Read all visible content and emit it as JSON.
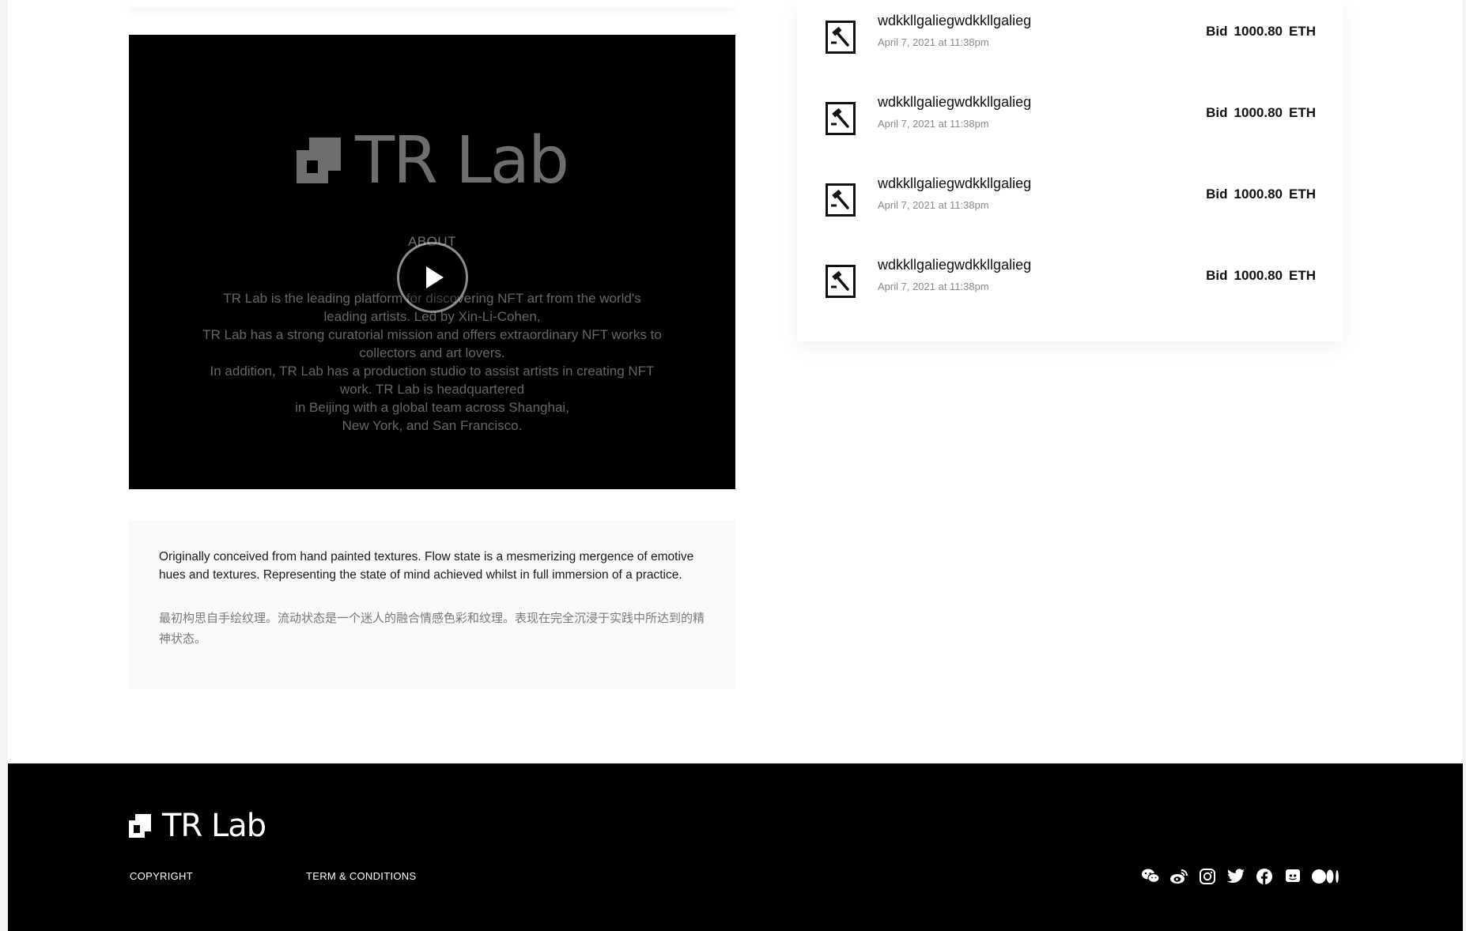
{
  "video": {
    "logo_text": "TR Lab",
    "about_heading": "ABOUT",
    "description_lines": [
      "TR Lab is the leading platform for discovering NFT art from the world's",
      "leading artists. Led by Xin-Li-Cohen,",
      "TR Lab has a strong curatorial mission and offers extraordinary NFT works to",
      "collectors and art lovers.",
      "In addition, TR Lab has a production studio to assist artists in creating NFT",
      "work. TR Lab is headquartered",
      "in Beijing with a global team across Shanghai,",
      "New York, and San Francisco."
    ]
  },
  "description": {
    "english": "Originally conceived from hand painted textures. Flow state is a mesmerizing mergence of emotive hues and textures. Representing the state of mind achieved whilst in full immersion of a practice.",
    "chinese": "最初构思自手绘纹理。流动状态是一个迷人的融合情感色彩和纹理。表现在完全沉浸于实践中所达到的精神状态。"
  },
  "bids": [
    {
      "name": "wdkkllgaliegwdkkllgalieg",
      "date": "April 7, 2021 at 11:38pm",
      "bid_label": "Bid",
      "amount": "1000.80",
      "currency": "ETH"
    },
    {
      "name": "wdkkllgaliegwdkkllgalieg",
      "date": "April 7, 2021 at 11:38pm",
      "bid_label": "Bid",
      "amount": "1000.80",
      "currency": "ETH"
    },
    {
      "name": "wdkkllgaliegwdkkllgalieg",
      "date": "April 7, 2021 at 11:38pm",
      "bid_label": "Bid",
      "amount": "1000.80",
      "currency": "ETH"
    },
    {
      "name": "wdkkllgaliegwdkkllgalieg",
      "date": "April 7, 2021 at 11:38pm",
      "bid_label": "Bid",
      "amount": "1000.80",
      "currency": "ETH"
    }
  ],
  "footer": {
    "logo_text": "TR Lab",
    "copyright": "COPYRIGHT",
    "terms": "TERM & CONDITIONS",
    "social_icons": [
      "wechat-icon",
      "weibo-icon",
      "instagram-icon",
      "twitter-icon",
      "facebook-icon",
      "discord-icon",
      "medium-icon"
    ]
  }
}
